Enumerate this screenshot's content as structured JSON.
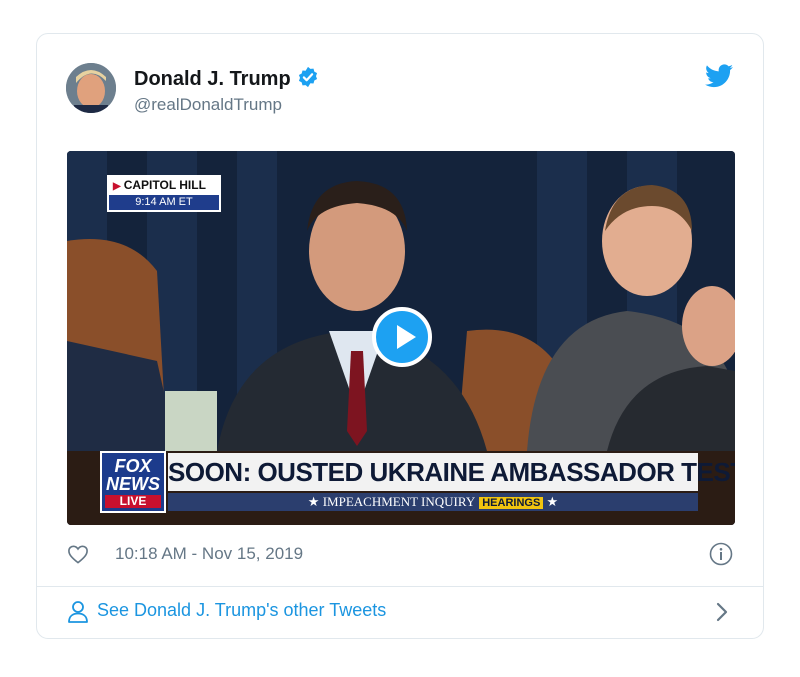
{
  "tweet": {
    "author_name": "Donald J. Trump",
    "handle": "@realDonaldTrump",
    "timestamp": "10:18 AM - Nov 15, 2019",
    "see_more": "See Donald J. Trump's other Tweets"
  },
  "video": {
    "location": "CAPITOL HILL",
    "location_time": "9:14 AM ET",
    "network_line1": "FOX",
    "network_line2": "NEWS",
    "network_live": "LIVE",
    "headline": "SOON: OUSTED UKRAINE AMBASSADOR TESTIFIES",
    "subline": "IMPEACHMENT INQUIRY",
    "subline_highlight": "HEARINGS"
  },
  "icons": {
    "verified": "verified-badge-icon",
    "brand": "twitter-bird-icon",
    "like": "heart-icon",
    "info": "info-icon",
    "profile": "user-icon",
    "more": "chevron-right-icon",
    "play": "play-icon"
  },
  "colors": {
    "accent": "#1da1f2",
    "link": "#1b95e0",
    "muted": "#657786",
    "border": "#e1e8ed"
  }
}
